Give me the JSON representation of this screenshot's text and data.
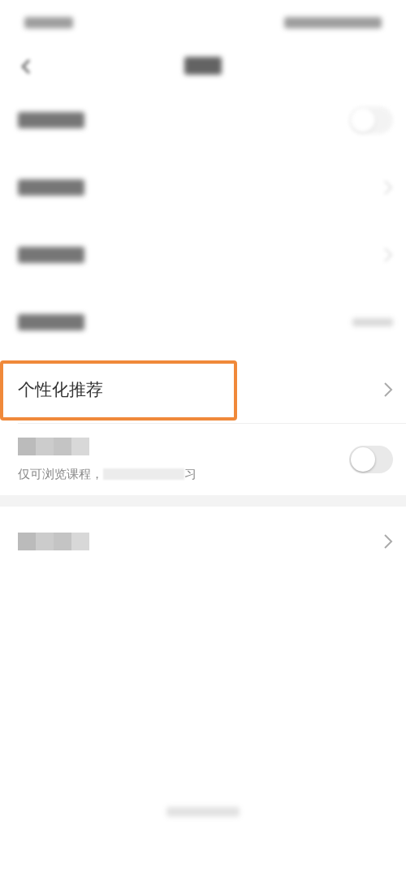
{
  "rows": [
    {
      "kind": "toggle",
      "redacted": true,
      "on": false,
      "faint": true
    },
    {
      "kind": "chevron",
      "redacted": true,
      "faint": true
    },
    {
      "kind": "chevron",
      "redacted": true,
      "faint": true
    },
    {
      "kind": "value",
      "redacted": true,
      "faint": true
    },
    {
      "kind": "chevron",
      "label": "个性化推荐",
      "highlighted": true
    },
    {
      "kind": "toggle",
      "mosaic": true,
      "on": false,
      "subtitle_parts": [
        "仅可浏览课程，",
        "习"
      ]
    },
    {
      "kind": "chevron",
      "mosaic": true,
      "separated": true
    }
  ]
}
